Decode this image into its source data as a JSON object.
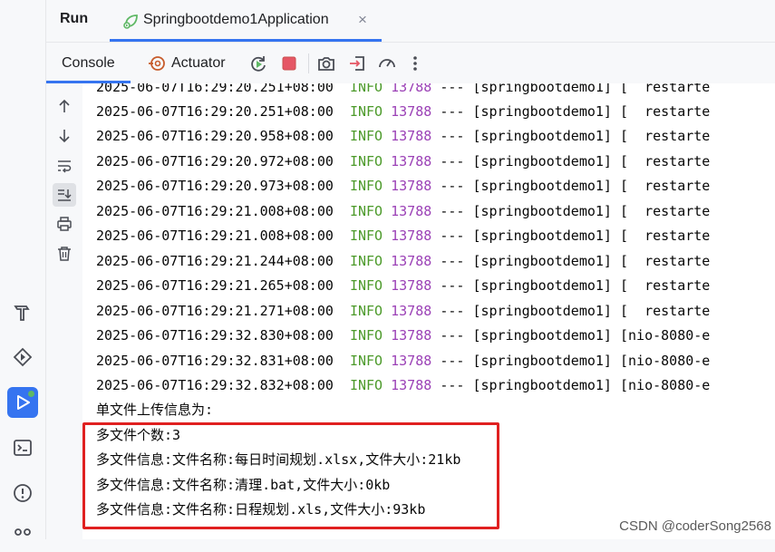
{
  "header": {
    "run_title": "Run",
    "app_tab_label": "Springbootdemo1Application",
    "close_glyph": "×"
  },
  "toolbar": {
    "console_label": "Console",
    "actuator_label": "Actuator",
    "icons": [
      "rerun-icon",
      "stop-icon",
      "camera-icon",
      "exit-icon",
      "dashboard-icon",
      "more-icon"
    ]
  },
  "side_tools": [
    "arrow-up-icon",
    "arrow-down-icon",
    "soft-wrap-icon",
    "scroll-to-end-icon",
    "print-icon",
    "trash-icon"
  ],
  "left_bar": [
    "build-icon",
    "services-icon",
    "run-icon",
    "terminal-icon",
    "problems-icon",
    "git-icon"
  ],
  "log": {
    "level": "INFO",
    "pid": "13788",
    "sep": "---",
    "timestamps": [
      "2025-06-07T16:29:20.251+08:00",
      "2025-06-07T16:29:20.251+08:00",
      "2025-06-07T16:29:20.958+08:00",
      "2025-06-07T16:29:20.972+08:00",
      "2025-06-07T16:29:20.973+08:00",
      "2025-06-07T16:29:21.008+08:00",
      "2025-06-07T16:29:21.008+08:00",
      "2025-06-07T16:29:21.244+08:00",
      "2025-06-07T16:29:21.265+08:00",
      "2025-06-07T16:29:21.271+08:00",
      "2025-06-07T16:29:32.830+08:00",
      "2025-06-07T16:29:32.831+08:00",
      "2025-06-07T16:29:32.832+08:00"
    ],
    "threads": [
      "[springbootdemo1] [  restarte",
      "[springbootdemo1] [  restarte",
      "[springbootdemo1] [  restarte",
      "[springbootdemo1] [  restarte",
      "[springbootdemo1] [  restarte",
      "[springbootdemo1] [  restarte",
      "[springbootdemo1] [  restarte",
      "[springbootdemo1] [  restarte",
      "[springbootdemo1] [  restarte",
      "[springbootdemo1] [  restarte",
      "[springbootdemo1] [nio-8080-e",
      "[springbootdemo1] [nio-8080-e",
      "[springbootdemo1] [nio-8080-e"
    ],
    "plain_lines": [
      "单文件上传信息为:",
      "多文件个数:3",
      "多文件信息:文件名称:每日时间规划.xlsx,文件大小:21kb",
      "多文件信息:文件名称:清理.bat,文件大小:0kb",
      "多文件信息:文件名称:日程规划.xls,文件大小:93kb"
    ]
  },
  "watermark": "CSDN @coderSong2568",
  "colors": {
    "accent": "#3574f0",
    "info": "#4c9a2a",
    "pid": "#9b41b6",
    "highlight": "#e02020"
  }
}
